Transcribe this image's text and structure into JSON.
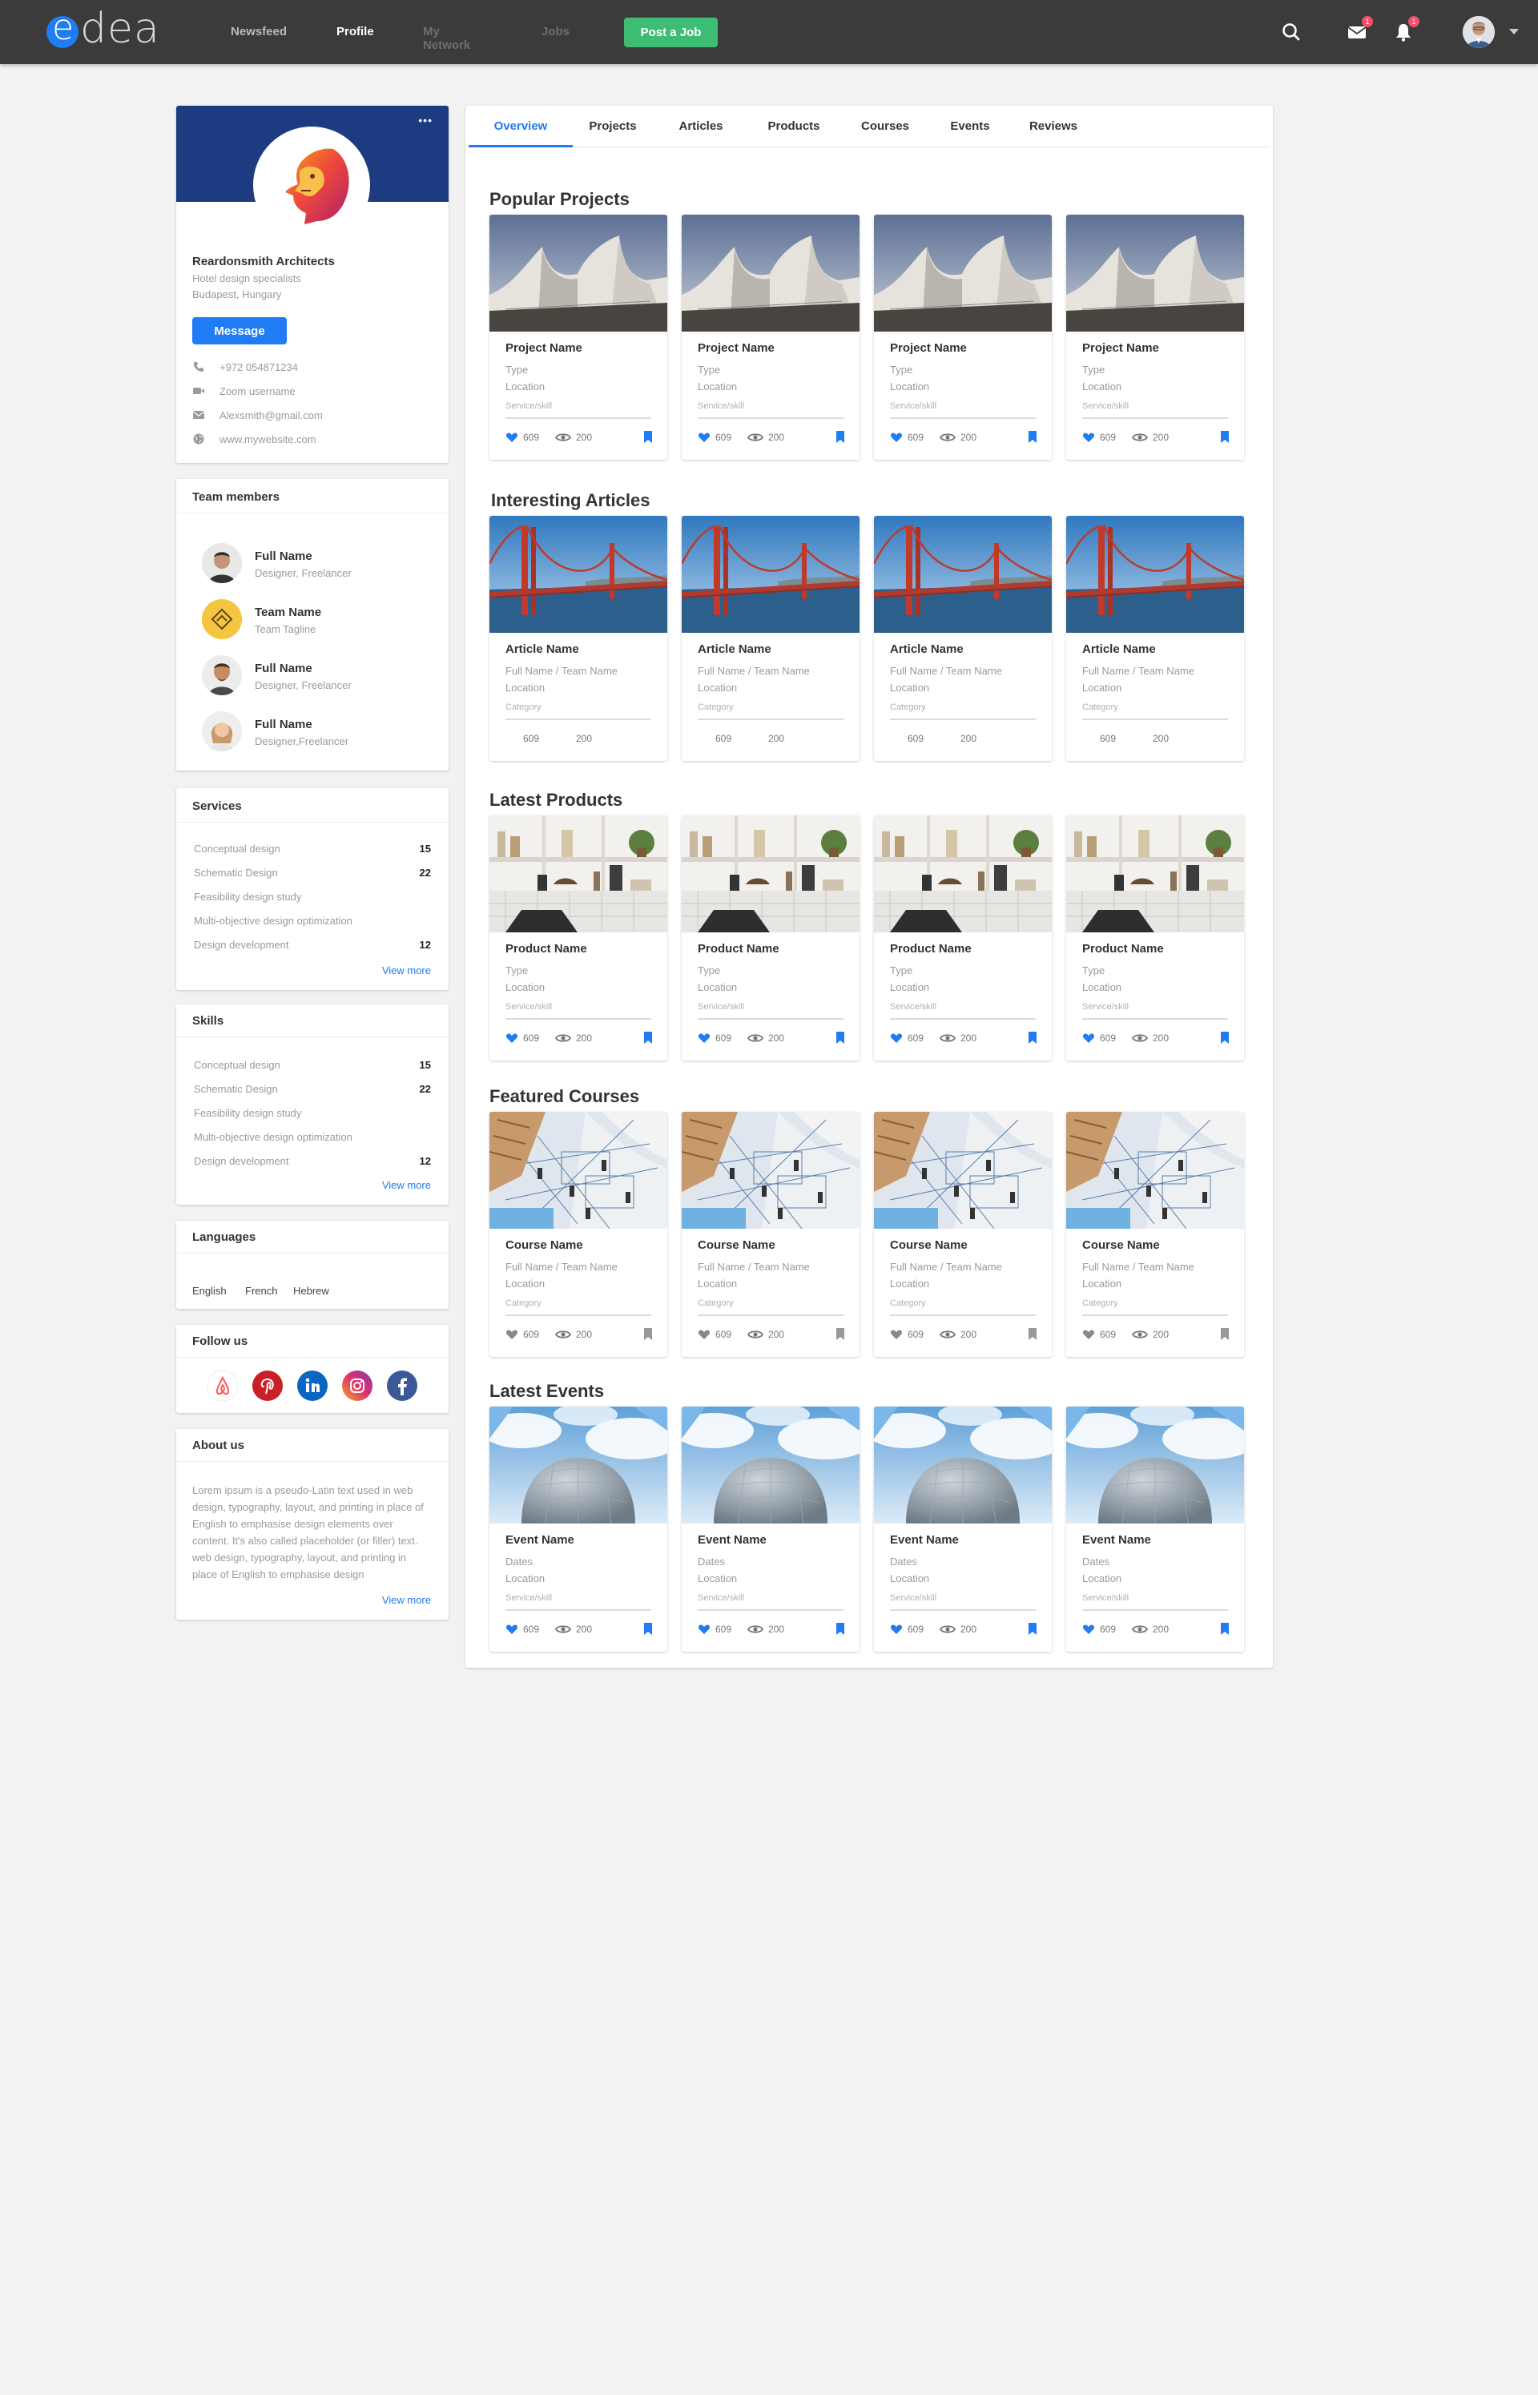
{
  "brand": {
    "name_first": "e",
    "name_rest": "dea"
  },
  "nav": [
    {
      "label": "Newsfeed",
      "state": "normal"
    },
    {
      "label": "Profile",
      "state": "active"
    },
    {
      "label": "My Network",
      "state": "dim"
    },
    {
      "label": "Jobs",
      "state": "dim"
    }
  ],
  "topbar": {
    "post_job_label": "Post a Job",
    "mail_badge": "1",
    "bell_badge": "1"
  },
  "profile": {
    "name": "Reardonsmith Architects",
    "tagline": "Hotel design specialists",
    "location": "Budapest, Hungary",
    "more_label": "•••",
    "message_label": "Message",
    "phone": "+972 054871234",
    "zoom": "Zoom username",
    "email": "Alexsmith@gmail.com",
    "website": "www.mywebsite.com"
  },
  "team": {
    "title": "Team members",
    "members": [
      {
        "name": "Full Name",
        "sub": "Designer, Freelancer"
      },
      {
        "name": "Team Name",
        "sub": "Team Tagline"
      },
      {
        "name": "Full Name",
        "sub": "Designer, Freelancer"
      },
      {
        "name": "Full Name",
        "sub": "Designer,Freelancer"
      }
    ]
  },
  "services": {
    "title": "Services",
    "rows": [
      {
        "label": "Conceptual design",
        "count": "15"
      },
      {
        "label": "Schematic Design",
        "count": "22"
      },
      {
        "label": "Feasibility design study",
        "count": ""
      },
      {
        "label": "Multi-objective design optimization",
        "count": ""
      },
      {
        "label": "Design development",
        "count": "12"
      }
    ],
    "view_more": "View more"
  },
  "skills": {
    "title": "Skills",
    "rows": [
      {
        "label": "Conceptual design",
        "count": "15"
      },
      {
        "label": "Schematic Design",
        "count": "22"
      },
      {
        "label": "Feasibility design study",
        "count": ""
      },
      {
        "label": "Multi-objective design optimization",
        "count": ""
      },
      {
        "label": "Design development",
        "count": "12"
      }
    ],
    "view_more": "View more"
  },
  "languages": {
    "title": "Languages",
    "items": [
      "English",
      "French",
      "Hebrew"
    ]
  },
  "follow": {
    "title": "Follow us"
  },
  "about": {
    "title": "About us",
    "text": "Lorem ipsum is a pseudo-Latin text used in web design, typography, layout, and printing in place of English to emphasise design elements over content. It's also called placeholder (or filler) text. web design, typography, layout, and printing in place of English to emphasise design",
    "view_more": "View more"
  },
  "tabs": [
    "Overview",
    "Projects",
    "Articles",
    "Products",
    "Courses",
    "Events",
    "Reviews"
  ],
  "sections": [
    {
      "title": "Popular Projects",
      "kind": "project",
      "l1": "Project Name",
      "l2": "Type",
      "l3": "Location",
      "l4": "Service/skill",
      "likes": "609",
      "views": "200",
      "icons": "blue"
    },
    {
      "title": "Interesting Articles",
      "kind": "article",
      "l1": "Article Name",
      "l2": "Full Name / Team Name",
      "l3": "Location",
      "l4": "Category",
      "likes": "609",
      "views": "200",
      "icons": "none"
    },
    {
      "title": "Latest Products",
      "kind": "product",
      "l1": "Product Name",
      "l2": "Type",
      "l3": "Location",
      "l4": "Service/skill",
      "likes": "609",
      "views": "200",
      "icons": "blue"
    },
    {
      "title": "Featured Courses",
      "kind": "course",
      "l1": "Course Name",
      "l2": "Full Name / Team Name",
      "l3": "Location",
      "l4": "Category",
      "likes": "609",
      "views": "200",
      "icons": "grey"
    },
    {
      "title": "Latest Events",
      "kind": "event",
      "l1": "Event Name",
      "l2": "Dates",
      "l3": "Location",
      "l4": "Service/skill",
      "likes": "609",
      "views": "200",
      "icons": "blue"
    }
  ],
  "colors": {
    "accent": "#1f7cf2",
    "topbar": "#3b3b3b",
    "post_job": "#3dbd74",
    "banner": "#1d3b80",
    "badge": "#f3506a"
  }
}
